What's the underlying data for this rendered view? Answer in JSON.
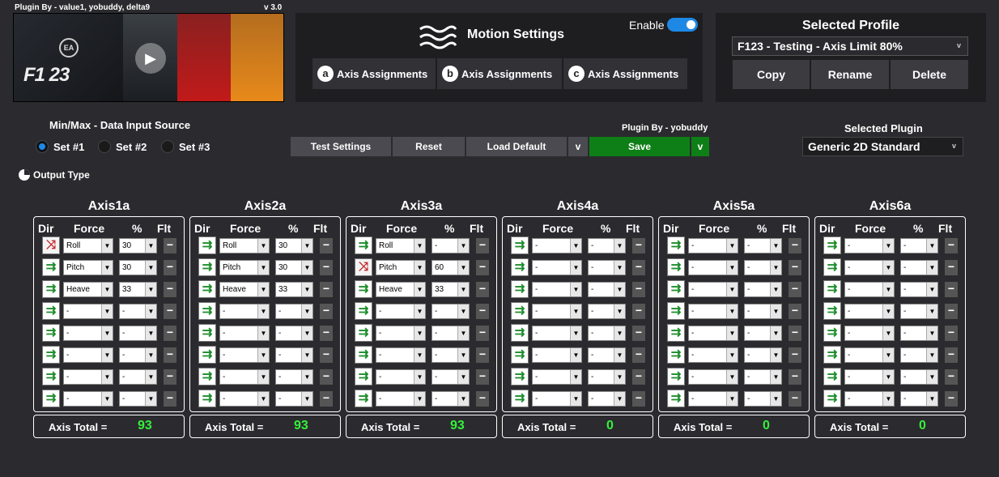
{
  "header": {
    "plugin_by": "Plugin By - value1, yobuddy, delta9",
    "version": "v 3.0"
  },
  "banner": {
    "game_logo": "F1 23",
    "publisher": "EA"
  },
  "motion": {
    "title": "Motion Settings",
    "enable_label": "Enable",
    "enabled": true,
    "tabs": [
      {
        "letter": "a",
        "label": "Axis Assignments"
      },
      {
        "letter": "b",
        "label": "Axis Assignments"
      },
      {
        "letter": "c",
        "label": "Axis Assignments"
      }
    ]
  },
  "profile": {
    "heading": "Selected Profile",
    "selected": "F123 - Testing - Axis Limit 80%",
    "buttons": [
      "Copy",
      "Rename",
      "Delete"
    ]
  },
  "input_source": {
    "label": "Min/Max - Data Input Source",
    "options": [
      "Set #1",
      "Set #2",
      "Set #3"
    ],
    "selected": "Set #1"
  },
  "output_type_label": "Output Type",
  "toolbar": {
    "test": "Test Settings",
    "reset": "Reset",
    "load_default": "Load Default",
    "save": "Save",
    "dropdown": "v",
    "plugin_by": "Plugin By - yobuddy"
  },
  "plugin": {
    "heading": "Selected Plugin",
    "selected": "Generic 2D Standard",
    "chevron": "v"
  },
  "axis_headers": {
    "dir": "Dir",
    "force": "Force",
    "pct": "%",
    "flt": "Flt"
  },
  "total_label": "Axis Total =",
  "axes": [
    {
      "name": "Axis1a",
      "total": "93",
      "rows": [
        {
          "dir": "inverse",
          "force": "Roll",
          "pct": "30"
        },
        {
          "dir": "normal",
          "force": "Pitch",
          "pct": "30"
        },
        {
          "dir": "normal",
          "force": "Heave",
          "pct": "33"
        },
        {
          "dir": "normal",
          "force": "-",
          "pct": "-"
        },
        {
          "dir": "normal",
          "force": "-",
          "pct": "-"
        },
        {
          "dir": "normal",
          "force": "-",
          "pct": "-"
        },
        {
          "dir": "normal",
          "force": "-",
          "pct": "-"
        },
        {
          "dir": "normal",
          "force": "-",
          "pct": "-"
        }
      ]
    },
    {
      "name": "Axis2a",
      "total": "93",
      "rows": [
        {
          "dir": "normal",
          "force": "Roll",
          "pct": "30"
        },
        {
          "dir": "normal",
          "force": "Pitch",
          "pct": "30"
        },
        {
          "dir": "normal",
          "force": "Heave",
          "pct": "33"
        },
        {
          "dir": "normal",
          "force": "-",
          "pct": "-"
        },
        {
          "dir": "normal",
          "force": "-",
          "pct": "-"
        },
        {
          "dir": "normal",
          "force": "-",
          "pct": "-"
        },
        {
          "dir": "normal",
          "force": "-",
          "pct": "-"
        },
        {
          "dir": "normal",
          "force": "-",
          "pct": "-"
        }
      ]
    },
    {
      "name": "Axis3a",
      "total": "93",
      "rows": [
        {
          "dir": "normal",
          "force": "Roll",
          "pct": "-"
        },
        {
          "dir": "inverse",
          "force": "Pitch",
          "pct": "60"
        },
        {
          "dir": "normal",
          "force": "Heave",
          "pct": "33"
        },
        {
          "dir": "normal",
          "force": "-",
          "pct": "-"
        },
        {
          "dir": "normal",
          "force": "-",
          "pct": "-"
        },
        {
          "dir": "normal",
          "force": "-",
          "pct": "-"
        },
        {
          "dir": "normal",
          "force": "-",
          "pct": "-"
        },
        {
          "dir": "normal",
          "force": "-",
          "pct": "-"
        }
      ]
    },
    {
      "name": "Axis4a",
      "total": "0",
      "rows": [
        {
          "dir": "normal",
          "force": "-",
          "pct": "-"
        },
        {
          "dir": "normal",
          "force": "-",
          "pct": "-"
        },
        {
          "dir": "normal",
          "force": "-",
          "pct": "-"
        },
        {
          "dir": "normal",
          "force": "-",
          "pct": "-"
        },
        {
          "dir": "normal",
          "force": "-",
          "pct": "-"
        },
        {
          "dir": "normal",
          "force": "-",
          "pct": "-"
        },
        {
          "dir": "normal",
          "force": "-",
          "pct": "-"
        },
        {
          "dir": "normal",
          "force": "-",
          "pct": "-"
        }
      ]
    },
    {
      "name": "Axis5a",
      "total": "0",
      "rows": [
        {
          "dir": "normal",
          "force": "-",
          "pct": "-"
        },
        {
          "dir": "normal",
          "force": "-",
          "pct": "-"
        },
        {
          "dir": "normal",
          "force": "-",
          "pct": "-"
        },
        {
          "dir": "normal",
          "force": "-",
          "pct": "-"
        },
        {
          "dir": "normal",
          "force": "-",
          "pct": "-"
        },
        {
          "dir": "normal",
          "force": "-",
          "pct": "-"
        },
        {
          "dir": "normal",
          "force": "-",
          "pct": "-"
        },
        {
          "dir": "normal",
          "force": "-",
          "pct": "-"
        }
      ]
    },
    {
      "name": "Axis6a",
      "total": "0",
      "rows": [
        {
          "dir": "normal",
          "force": "-",
          "pct": "-"
        },
        {
          "dir": "normal",
          "force": "-",
          "pct": "-"
        },
        {
          "dir": "normal",
          "force": "-",
          "pct": "-"
        },
        {
          "dir": "normal",
          "force": "-",
          "pct": "-"
        },
        {
          "dir": "normal",
          "force": "-",
          "pct": "-"
        },
        {
          "dir": "normal",
          "force": "-",
          "pct": "-"
        },
        {
          "dir": "normal",
          "force": "-",
          "pct": "-"
        },
        {
          "dir": "normal",
          "force": "-",
          "pct": "-"
        }
      ]
    }
  ],
  "colors": {
    "accent": "#1e88e5",
    "save": "#0e7f16",
    "total_value": "#35f03a"
  }
}
